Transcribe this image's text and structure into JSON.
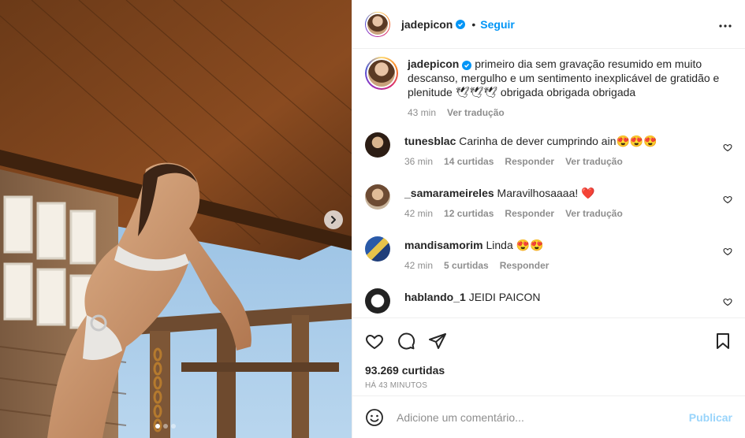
{
  "post": {
    "username": "jadepicon",
    "follow_label": "Seguir",
    "separator": "•"
  },
  "caption": {
    "username": "jadepicon",
    "text": "primeiro dia sem gravação resumido em muito descanso, mergulho e um sentimento inexplicável de gratidão e plenitude 🕊🕊🕊 obrigada obrigada obrigada",
    "time": "43 min",
    "translate_label": "Ver tradução"
  },
  "comments": [
    {
      "username": "tunesblac",
      "text": "Carinha de dever cumprindo ain😍😍😍",
      "time": "36 min",
      "likes": "14 curtidas",
      "reply": "Responder",
      "translate": "Ver tradução"
    },
    {
      "username": "_samarameireles",
      "text": "Maravilhosaaaa! ❤️",
      "time": "42 min",
      "likes": "12 curtidas",
      "reply": "Responder",
      "translate": "Ver tradução"
    },
    {
      "username": "mandisamorim",
      "text": "Linda 😍😍",
      "time": "42 min",
      "likes": "5 curtidas",
      "reply": "Responder"
    },
    {
      "username": "hablando_1",
      "text": "JEIDI PAICON"
    }
  ],
  "stats": {
    "likes": "93.269 curtidas",
    "time": "HÁ 43 MINUTOS"
  },
  "add_comment": {
    "placeholder": "Adicione um comentário...",
    "publish_label": "Publicar"
  },
  "carousel": {
    "current": 1,
    "total": 3
  },
  "colors": {
    "accent": "#0095f6",
    "text": "#262626",
    "muted": "#8e8e8e"
  }
}
